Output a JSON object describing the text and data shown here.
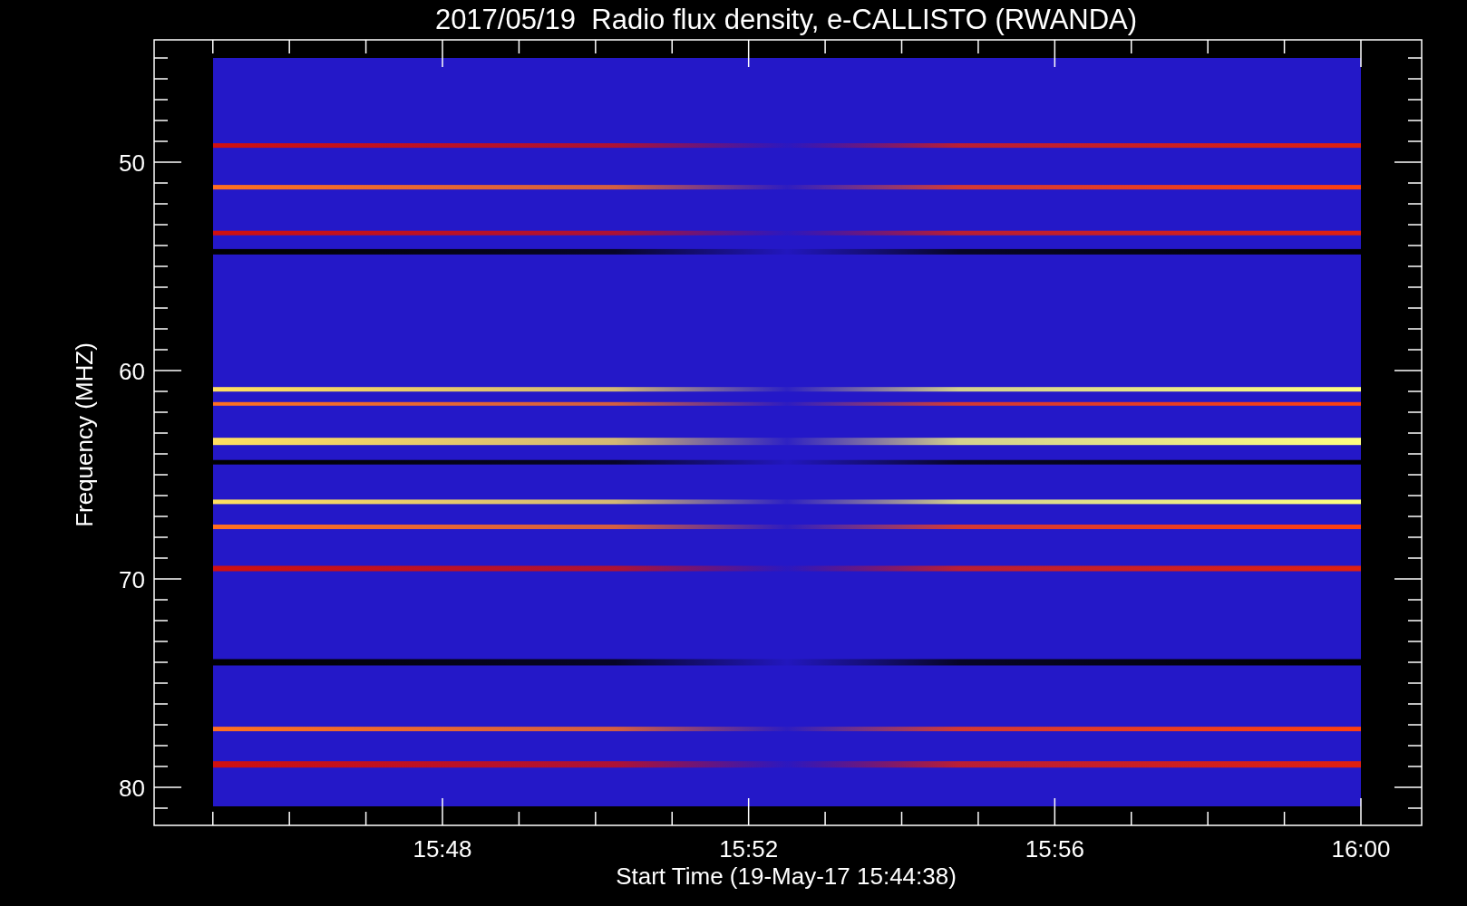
{
  "plot": {
    "title": "2017/05/19  Radio flux density, e-CALLISTO (RWANDA)",
    "xlabel": "Start Time (19-May-17 15:44:38)",
    "ylabel": "Frequency (MHZ)",
    "xticks": [
      "15:48",
      "15:52",
      "15:56",
      "16:00"
    ],
    "yticks": [
      "50",
      "60",
      "70",
      "80"
    ]
  }
}
